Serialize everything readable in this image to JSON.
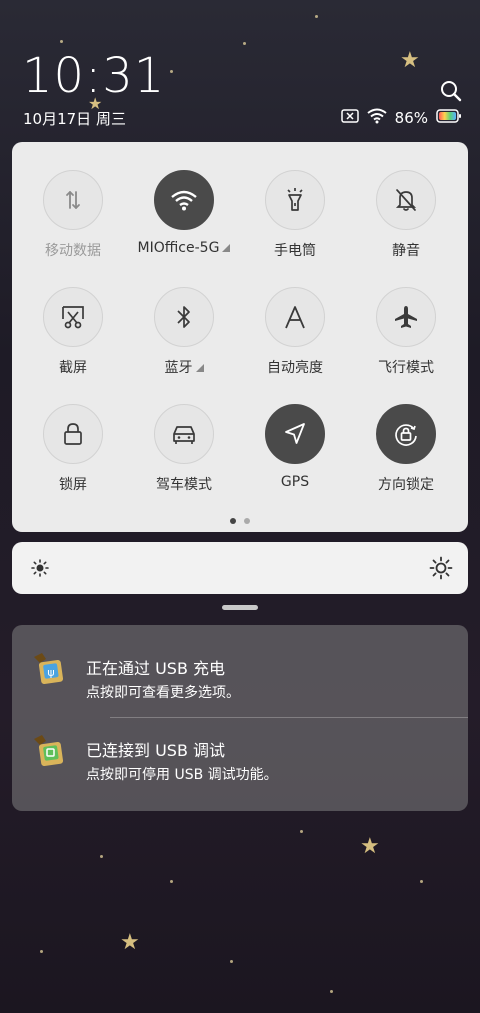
{
  "status_bar": {
    "time": "10:31",
    "date": "10月17日 周三",
    "battery": "86%"
  },
  "quick_settings": {
    "tiles": [
      {
        "label": "移动数据",
        "active": false,
        "dim": true,
        "icon": "mobile-data-icon"
      },
      {
        "label": "MIOffice-5G",
        "active": true,
        "icon": "wifi-icon",
        "has_dropdown": true
      },
      {
        "label": "手电筒",
        "active": false,
        "icon": "flashlight-icon"
      },
      {
        "label": "静音",
        "active": false,
        "icon": "bell-mute-icon"
      },
      {
        "label": "截屏",
        "active": false,
        "icon": "screenshot-icon"
      },
      {
        "label": "蓝牙",
        "active": false,
        "icon": "bluetooth-icon",
        "has_dropdown": true
      },
      {
        "label": "自动亮度",
        "active": false,
        "icon": "auto-brightness-icon"
      },
      {
        "label": "飞行模式",
        "active": false,
        "icon": "airplane-icon"
      },
      {
        "label": "锁屏",
        "active": false,
        "icon": "lock-icon"
      },
      {
        "label": "驾车模式",
        "active": false,
        "icon": "car-icon"
      },
      {
        "label": "GPS",
        "active": true,
        "icon": "location-icon"
      },
      {
        "label": "方向锁定",
        "active": true,
        "icon": "rotation-lock-icon"
      }
    ],
    "page_count": 2,
    "current_page": 1
  },
  "notifications": [
    {
      "title": "正在通过 USB 充电",
      "subtitle": "点按即可查看更多选项。",
      "icon": "usb-charging-icon"
    },
    {
      "title": "已连接到 USB 调试",
      "subtitle": "点按即可停用 USB 调试功能。",
      "icon": "usb-debug-icon"
    }
  ],
  "colors": {
    "tile_active": "#4a4a4a",
    "panel": "#ebebeb",
    "battery_gradient": [
      "#ff5a5a",
      "#ffd34d",
      "#5ad27a",
      "#5ab0ff"
    ]
  }
}
